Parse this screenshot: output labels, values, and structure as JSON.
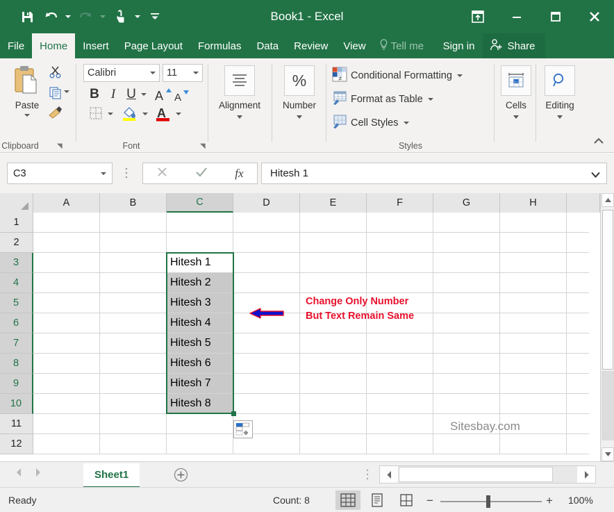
{
  "app": {
    "title": "Book1 - Excel",
    "watermark": "Sitesbay.com"
  },
  "quick_access": {
    "save": "save-icon",
    "undo": "undo-icon",
    "redo": "redo-icon",
    "touch_mode": "touch-mouse-mode-icon",
    "customize": "customize-qat-icon"
  },
  "window_controls": {
    "ribbon_display": "ribbon-display-options-icon",
    "minimize": "minimize-icon",
    "restore": "restore-icon",
    "close": "close-icon"
  },
  "tabs": [
    {
      "label": "File",
      "active": false
    },
    {
      "label": "Home",
      "active": true
    },
    {
      "label": "Insert",
      "active": false
    },
    {
      "label": "Page Layout",
      "active": false
    },
    {
      "label": "Formulas",
      "active": false
    },
    {
      "label": "Data",
      "active": false
    },
    {
      "label": "Review",
      "active": false
    },
    {
      "label": "View",
      "active": false
    }
  ],
  "tellme": {
    "placeholder": "Tell me"
  },
  "signin": {
    "label": "Sign in"
  },
  "share": {
    "label": "Share"
  },
  "ribbon": {
    "groups": {
      "clipboard": {
        "label": "Clipboard",
        "paste_label": "Paste",
        "cut": "cut-scissors-icon",
        "copy": "copy-icon",
        "format_painter": "format-painter-icon"
      },
      "font": {
        "label": "Font",
        "font_name": "Calibri",
        "font_size": "11",
        "bold": "B",
        "italic": "I",
        "underline": "U",
        "grow_font": "A",
        "shrink_font": "A",
        "borders": "borders-icon",
        "fill_color": "fill-color-icon",
        "font_color": "font-color-icon"
      },
      "alignment": {
        "label": "Alignment"
      },
      "number": {
        "label": "Number",
        "icon_glyph": "%"
      },
      "styles": {
        "label": "Styles",
        "items": [
          {
            "label": "Conditional Formatting"
          },
          {
            "label": "Format as Table"
          },
          {
            "label": "Cell Styles"
          }
        ]
      },
      "cells": {
        "label": "Cells"
      },
      "editing": {
        "label": "Editing"
      }
    },
    "collapse": "collapse-ribbon-icon"
  },
  "formula_bar": {
    "name_box": "C3",
    "cancel": "cancel-icon",
    "enter": "enter-check-icon",
    "insert_function": "fx",
    "value": "Hitesh 1",
    "expand": "expand-formula-bar-icon"
  },
  "grid": {
    "columns": [
      "A",
      "B",
      "C",
      "D",
      "E",
      "F",
      "G",
      "H"
    ],
    "selected_column": "C",
    "rows": [
      "1",
      "2",
      "3",
      "4",
      "5",
      "6",
      "7",
      "8",
      "9",
      "10",
      "11",
      "12"
    ],
    "selected_rows": [
      "3",
      "4",
      "5",
      "6",
      "7",
      "8",
      "9",
      "10"
    ],
    "active_cell": "C3",
    "selection_range": "C3:C10",
    "cells": [
      {
        "col": "C",
        "row": "3",
        "value": "Hitesh 1",
        "active": true
      },
      {
        "col": "C",
        "row": "4",
        "value": "Hitesh 2",
        "active": false
      },
      {
        "col": "C",
        "row": "5",
        "value": "Hitesh 3",
        "active": false
      },
      {
        "col": "C",
        "row": "6",
        "value": "Hitesh 4",
        "active": false
      },
      {
        "col": "C",
        "row": "7",
        "value": "Hitesh 5",
        "active": false
      },
      {
        "col": "C",
        "row": "8",
        "value": "Hitesh 6",
        "active": false
      },
      {
        "col": "C",
        "row": "9",
        "value": "Hitesh 7",
        "active": false
      },
      {
        "col": "C",
        "row": "10",
        "value": "Hitesh 8",
        "active": false
      }
    ],
    "annotation": {
      "line1": "Change Only Number",
      "line2": "But Text Remain Same",
      "color": "#e8112d",
      "arrow": "left-arrow-annotation"
    },
    "autofill_options": "auto-fill-options-icon"
  },
  "sheet_bar": {
    "first_prev": "nav-prev-icon",
    "next_last": "nav-next-icon",
    "sheets": [
      {
        "label": "Sheet1",
        "active": true
      }
    ],
    "add_sheet": "add-sheet-icon"
  },
  "status_bar": {
    "mode": "Ready",
    "count": "Count: 8",
    "views": [
      {
        "name": "normal-view",
        "active": true
      },
      {
        "name": "page-layout-view",
        "active": false
      },
      {
        "name": "page-break-preview",
        "active": false
      }
    ],
    "zoom_out": "−",
    "zoom_in": "+",
    "zoom_level": "100%"
  },
  "colors": {
    "brand_green": "#217346",
    "share_green": "#1d6b41",
    "ribbon_bg": "#f3f2f1",
    "annotation_red": "#e8112d",
    "arrow_blue": "#1111cc",
    "selection_gray": "#c9c9c9"
  }
}
